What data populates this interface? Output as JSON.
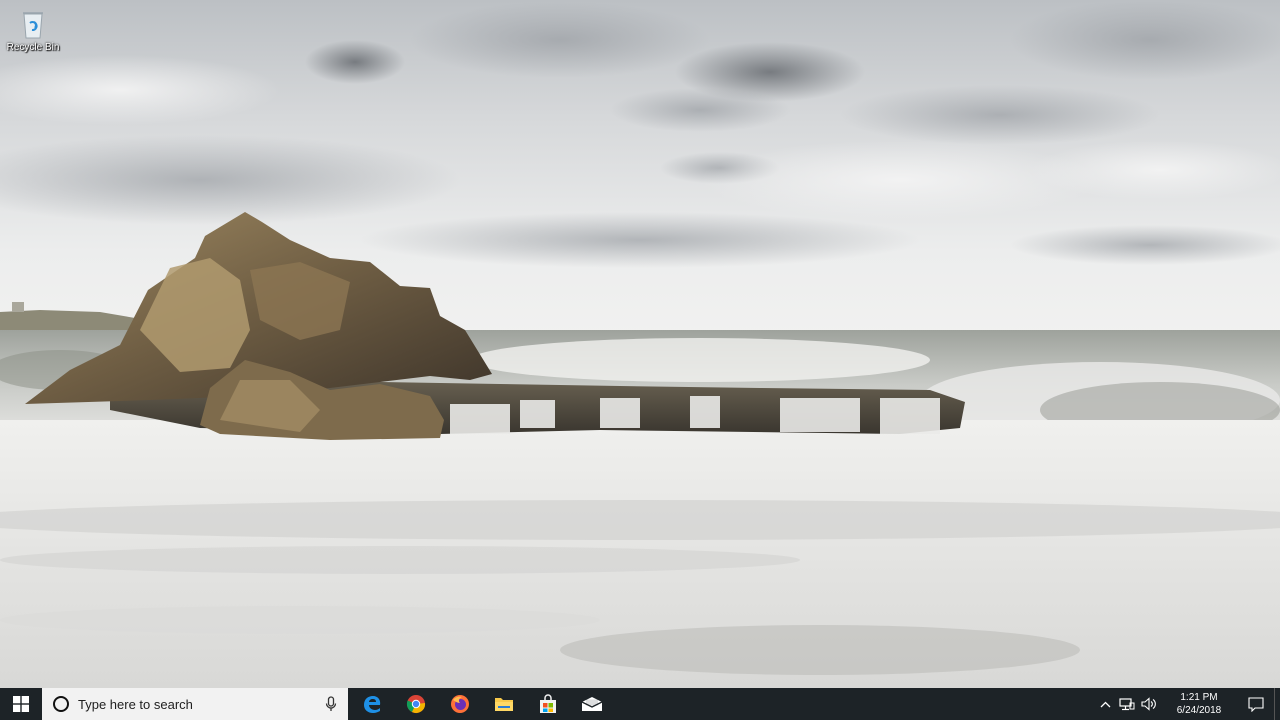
{
  "desktop": {
    "icons": [
      {
        "label": "Recycle Bin",
        "icon": "recycle-bin-icon"
      }
    ]
  },
  "taskbar": {
    "start": {
      "icon": "windows-logo-icon"
    },
    "search": {
      "placeholder": "Type here to search",
      "icon": "cortana-circle-icon",
      "mic_icon": "microphone-icon"
    },
    "pinned_apps": [
      {
        "name": "Microsoft Edge",
        "icon": "edge-icon"
      },
      {
        "name": "Google Chrome",
        "icon": "chrome-icon"
      },
      {
        "name": "Firefox",
        "icon": "firefox-icon"
      },
      {
        "name": "File Explorer",
        "icon": "file-explorer-icon"
      },
      {
        "name": "Microsoft Store",
        "icon": "store-icon"
      },
      {
        "name": "Mail",
        "icon": "mail-icon"
      }
    ],
    "tray": {
      "icons": [
        "chevron-up-icon",
        "network-icon",
        "volume-icon"
      ],
      "time": "1:21 PM",
      "date": "6/24/2018",
      "notification_icon": "action-center-icon"
    }
  },
  "colors": {
    "taskbar_bg": "#1d2327",
    "search_bg": "#f2f2f2",
    "edge_blue": "#1e90e6",
    "accent_text": "#ffffff"
  }
}
